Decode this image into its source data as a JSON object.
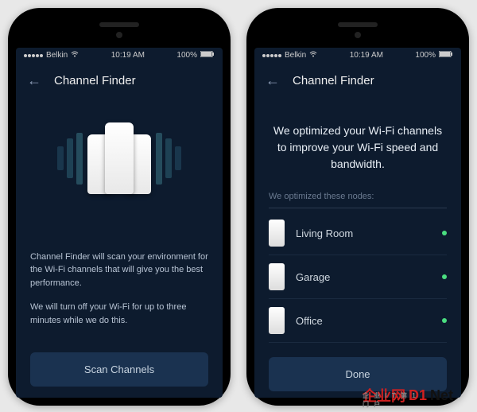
{
  "status_bar": {
    "carrier": "Belkin",
    "time": "10:19 AM",
    "battery": "100%"
  },
  "screen1": {
    "title": "Channel Finder",
    "desc1": "Channel Finder will scan your environment for the Wi-Fi channels that will give you the best performance.",
    "desc2": "We will turn off your Wi-Fi for up to three minutes while we do this.",
    "button": "Scan Channels"
  },
  "screen2": {
    "title": "Channel Finder",
    "summary": "We optimized your Wi-Fi channels to improve your Wi-Fi speed and bandwidth.",
    "section_label": "We optimized these nodes:",
    "nodes": [
      {
        "label": "Living Room"
      },
      {
        "label": "Garage"
      },
      {
        "label": "Office"
      }
    ],
    "button": "Done"
  },
  "watermark": {
    "part1": "企业网",
    "part2": "D1",
    "part3": "Net",
    "sub": "企 业 I T 第 1 门 户"
  }
}
